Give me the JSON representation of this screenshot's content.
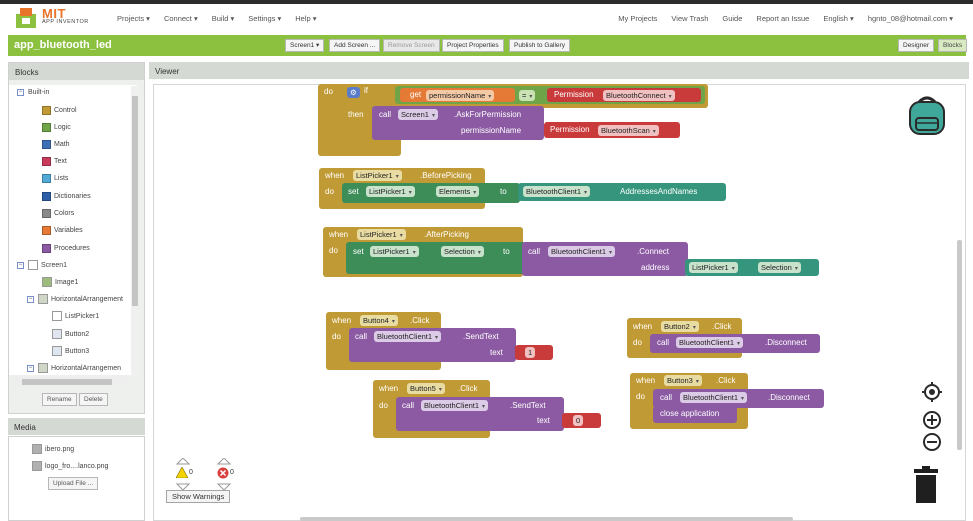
{
  "app": {
    "brand": "MIT",
    "subtitle": "APP INVENTOR"
  },
  "nav": {
    "left": [
      "Projects ▾",
      "Connect ▾",
      "Build ▾",
      "Settings ▾",
      "Help ▾"
    ],
    "right": [
      "My Projects",
      "View Trash",
      "Guide",
      "Report an Issue",
      "English ▾",
      "hgnto_08@hotmail.com ▾"
    ]
  },
  "project": {
    "name": "app_bluetooth_led",
    "screen_select": "Screen1 ▾",
    "add_screen": "Add Screen ...",
    "remove_screen": "Remove Screen",
    "properties": "Project Properties",
    "publish": "Publish to Gallery",
    "designer": "Designer",
    "blocks": "Blocks"
  },
  "blocks_panel": {
    "title": "Blocks",
    "builtin_label": "Built-in",
    "builtin": [
      {
        "label": "Control",
        "color": "#c09a34"
      },
      {
        "label": "Logic",
        "color": "#6fa548"
      },
      {
        "label": "Math",
        "color": "#3f6fb6"
      },
      {
        "label": "Text",
        "color": "#c93b5b"
      },
      {
        "label": "Lists",
        "color": "#52a9d6"
      },
      {
        "label": "Dictionaries",
        "color": "#2d5fa8"
      },
      {
        "label": "Colors",
        "color": "#8a8a8a"
      },
      {
        "label": "Variables",
        "color": "#e57a36"
      },
      {
        "label": "Procedures",
        "color": "#8b5aa2"
      }
    ],
    "screen_label": "Screen1",
    "components": [
      "Image1",
      "HorizontalArrangement",
      "ListPicker1",
      "Button2",
      "Button3",
      "HorizontalArrangemen"
    ],
    "rename": "Rename",
    "delete": "Delete"
  },
  "media": {
    "title": "Media",
    "files": [
      "ibero.png",
      "logo_fro....lanco.png"
    ],
    "upload": "Upload File ..."
  },
  "viewer": {
    "title": "Viewer",
    "warnings_count": "0",
    "errors_count": "0",
    "show_warnings": "Show Warnings"
  },
  "code": {
    "b1": {
      "do": "do",
      "if": "if",
      "get": "get",
      "permissionName": "permissionName",
      "eq": "=",
      "permission": "Permission",
      "bt_connect": "BluetoothConnect",
      "then": "then",
      "call": "call",
      "screen": "Screen1",
      "ask": ".AskForPermission",
      "arg": "permissionName",
      "bt_scan": "BluetoothScan"
    },
    "b2": {
      "when": "when",
      "comp": "ListPicker1",
      "event": ".BeforePicking",
      "do": "do",
      "set": "set",
      "prop": "Elements",
      "to": "to",
      "client": "BluetoothClient1",
      "addr": "AddressesAndNames"
    },
    "b3": {
      "when": "when",
      "comp": "ListPicker1",
      "event": ".AfterPicking",
      "do": "do",
      "set": "set",
      "prop": "Selection",
      "to": "to",
      "call": "call",
      "client": "BluetoothClient1",
      "method": ".Connect",
      "address": "address",
      "comp2": "ListPicker1",
      "prop2": "Selection"
    },
    "b4": {
      "when": "when",
      "comp": "Button4",
      "event": ".Click",
      "do": "do",
      "call": "call",
      "client": "BluetoothClient1",
      "method": ".SendText",
      "text": "text",
      "value": "1"
    },
    "b5": {
      "when": "when",
      "comp": "Button5",
      "event": ".Click",
      "do": "do",
      "call": "call",
      "client": "BluetoothClient1",
      "method": ".SendText",
      "text": "text",
      "value": "0"
    },
    "b6": {
      "when": "when",
      "comp": "Button2",
      "event": ".Click",
      "do": "do",
      "call": "call",
      "client": "BluetoothClient1",
      "method": ".Disconnect"
    },
    "b7": {
      "when": "when",
      "comp": "Button3",
      "event": ".Click",
      "do": "do",
      "call": "call",
      "client": "BluetoothClient1",
      "method": ".Disconnect",
      "close": "close application"
    }
  }
}
